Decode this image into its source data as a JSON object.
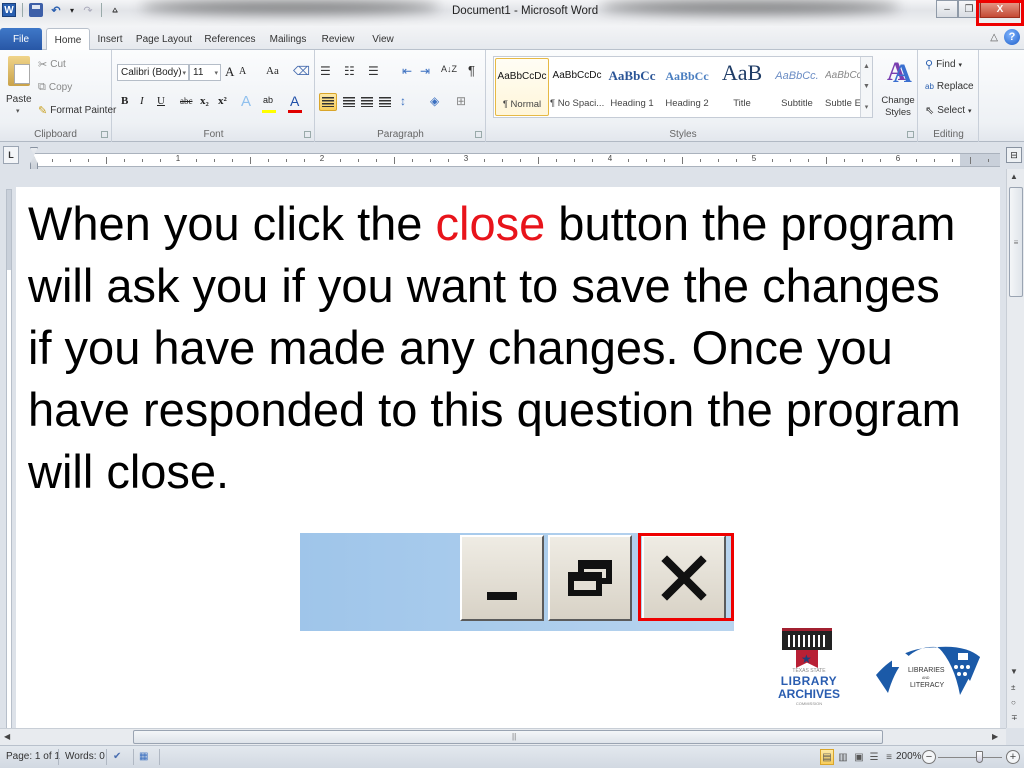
{
  "window": {
    "title": "Document1 - Microsoft Word",
    "controls": {
      "minimize": "–",
      "restore": "❐",
      "close": "X"
    },
    "close_highlight_color": "#e00000"
  },
  "quick_access": {
    "app_icon": "W",
    "undo": "↶",
    "undo_dropdown": "▾",
    "redo": "↷",
    "customize": "⩠"
  },
  "tabs": [
    {
      "label": "File"
    },
    {
      "label": "Home",
      "active": true
    },
    {
      "label": "Insert"
    },
    {
      "label": "Page Layout"
    },
    {
      "label": "References"
    },
    {
      "label": "Mailings"
    },
    {
      "label": "Review"
    },
    {
      "label": "View"
    }
  ],
  "help": {
    "minimize_ribbon": "△",
    "help": "?"
  },
  "ribbon": {
    "clipboard": {
      "label": "Clipboard",
      "paste": "Paste",
      "paste_arrow": "▾",
      "cut": "Cut",
      "copy": "Copy",
      "format_painter": "Format Painter"
    },
    "font": {
      "label": "Font",
      "font_name": "Calibri (Body)",
      "font_size": "11",
      "grow": "A",
      "shrink": "A",
      "change_case": "Aa",
      "clear_format": "⌫",
      "bold": "B",
      "italic": "I",
      "underline": "U",
      "strikethrough": "abc",
      "subscript": "x₂",
      "superscript": "x²",
      "text_effects": "A",
      "highlight": "ab",
      "font_color": "A",
      "highlight_color": "#ffff00",
      "font_color_value": "#e00000"
    },
    "paragraph": {
      "label": "Paragraph",
      "bullets": "☰",
      "numbering": "☷",
      "multilevel": "☰",
      "decrease_indent": "⇤",
      "increase_indent": "⇥",
      "sort": "A↓Z",
      "show_marks": "¶",
      "line_spacing": "↕",
      "shading": "◈",
      "borders": "⊞"
    },
    "styles": {
      "label": "Styles",
      "items": [
        {
          "sample": "AaBbCcDc",
          "name": "¶ Normal",
          "selected": true
        },
        {
          "sample": "AaBbCcDc",
          "name": "¶ No Spaci..."
        },
        {
          "sample": "AaBbCc",
          "name": "Heading 1"
        },
        {
          "sample": "AaBbCc",
          "name": "Heading 2"
        },
        {
          "sample": "AaB",
          "name": "Title"
        },
        {
          "sample": "AaBbCc.",
          "name": "Subtitle"
        },
        {
          "sample": "AaBbCcDc",
          "name": "Subtle Em..."
        }
      ],
      "change_styles": "Change Styles",
      "change_styles_arrow": "▾"
    },
    "editing": {
      "label": "Editing",
      "find": "Find",
      "replace": "Replace",
      "select": "Select"
    }
  },
  "ruler": {
    "tab_selector": "L",
    "numbers": [
      "1",
      "2",
      "3",
      "4",
      "5",
      "6"
    ]
  },
  "document": {
    "text_before": "When you click the ",
    "text_highlight": "close",
    "text_after": " button the program will ask you if you want to save the changes if you have made any changes. Once you have responded to this question the program will close.",
    "highlight_color": "#e8141b",
    "illustration": {
      "minimize_label": "Minimize",
      "restore_label": "Restore",
      "close_label": "Close"
    },
    "logos": {
      "tsl": {
        "small": "TEXAS STATE",
        "line1": "LIBRARY",
        "line2": "ARCHIVES",
        "sub": "COMMISSION"
      },
      "literacy": {
        "line1": "LIBRARIES",
        "and": "AND",
        "line2": "LITERACY"
      }
    }
  },
  "scrollbars": {
    "up": "▲",
    "down": "▼",
    "left": "◀",
    "right": "▶",
    "grip": "≡",
    "hgrip": "||",
    "prev_page": "±",
    "browse": "○",
    "next_page": "∓"
  },
  "status": {
    "page": "Page: 1 of 1",
    "words": "Words: 0",
    "zoom": "200%",
    "zoom_out": "−",
    "zoom_in": "+"
  }
}
